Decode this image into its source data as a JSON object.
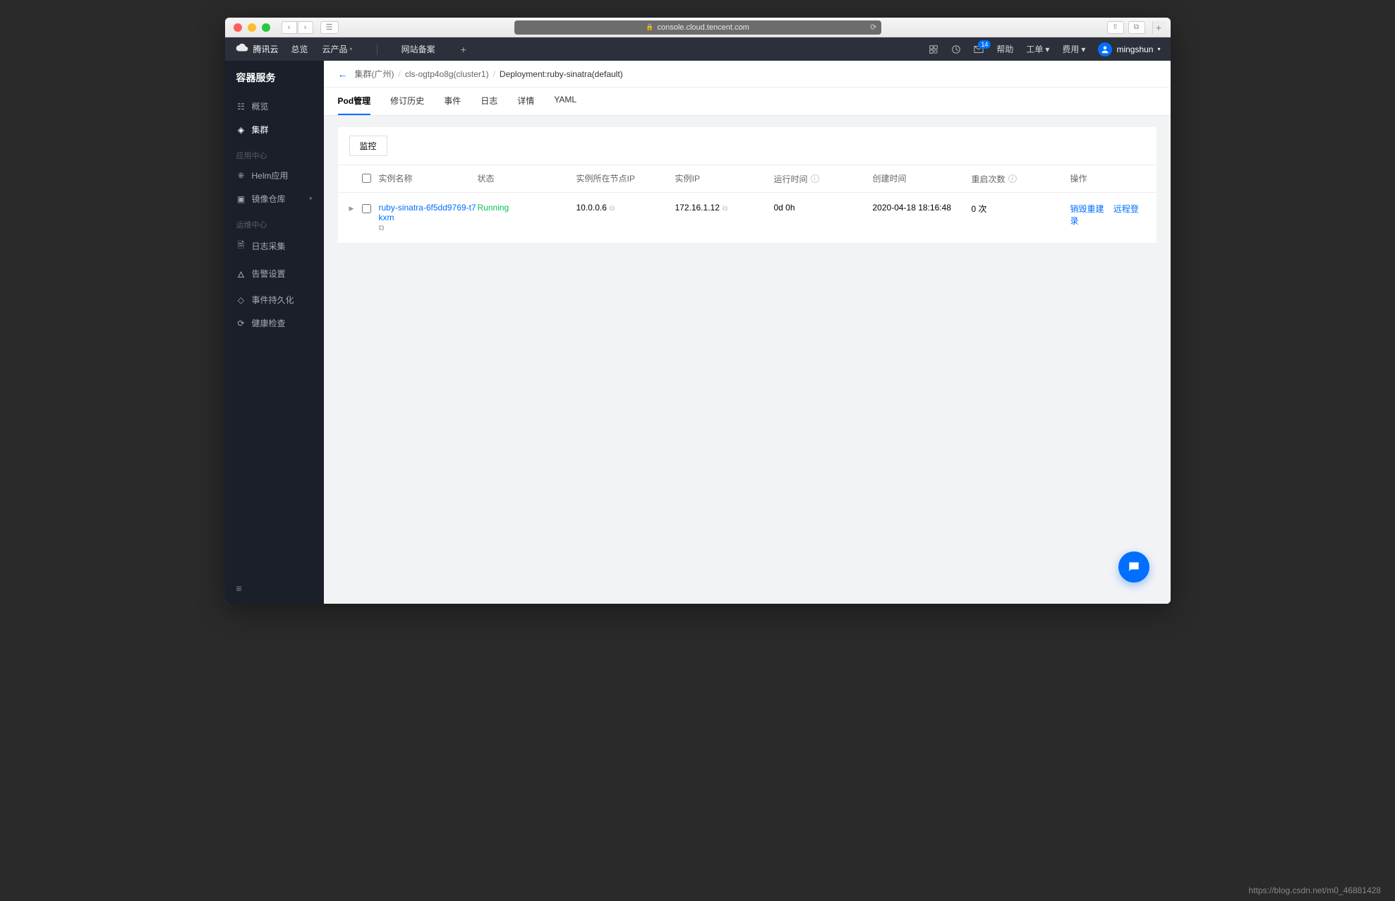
{
  "browser": {
    "url": "console.cloud.tencent.com"
  },
  "header": {
    "brand": "腾讯云",
    "nav": [
      "总览",
      "云产品",
      "网站备案"
    ],
    "help_label": "帮助",
    "msg_badge": "14",
    "work_order_label": "工单",
    "fee_label": "费用",
    "username": "mingshun"
  },
  "sidebar": {
    "title": "容器服务",
    "items0": [
      {
        "icon": "grid",
        "label": "概览"
      },
      {
        "icon": "cluster",
        "label": "集群",
        "active": true
      }
    ],
    "section1": "应用中心",
    "items1": [
      {
        "icon": "helm",
        "label": "Helm应用"
      },
      {
        "icon": "image",
        "label": "镜像仓库",
        "expand": true
      }
    ],
    "section2": "运维中心",
    "items2": [
      {
        "icon": "log",
        "label": "日志采集"
      },
      {
        "icon": "alarm",
        "label": "告警设置"
      },
      {
        "icon": "persist",
        "label": "事件持久化"
      },
      {
        "icon": "health",
        "label": "健康检查"
      }
    ]
  },
  "breadcrumb": {
    "b0": "集群(广州)",
    "b1": "cls-ogtp4o8g(cluster1)",
    "b2": "Deployment:ruby-sinatra(default)"
  },
  "tabs": [
    "Pod管理",
    "修订历史",
    "事件",
    "日志",
    "详情",
    "YAML"
  ],
  "toolbar": {
    "monitor": "监控"
  },
  "table": {
    "headers": {
      "name": "实例名称",
      "status": "状态",
      "nodeip": "实例所在节点IP",
      "podip": "实例IP",
      "runtime": "运行时间",
      "ctime": "创建时间",
      "restarts": "重启次数",
      "ops": "操作"
    },
    "rows": [
      {
        "name": "ruby-sinatra-6f5dd9769-t7kxm",
        "status": "Running",
        "nodeip": "10.0.0.6",
        "podip": "172.16.1.12",
        "runtime": "0d 0h",
        "ctime": "2020-04-18 18:16:48",
        "restarts": "0 次",
        "op_destroy": "销毁重建",
        "op_login": "远程登录"
      }
    ]
  },
  "watermark": "https://blog.csdn.net/m0_46881428"
}
